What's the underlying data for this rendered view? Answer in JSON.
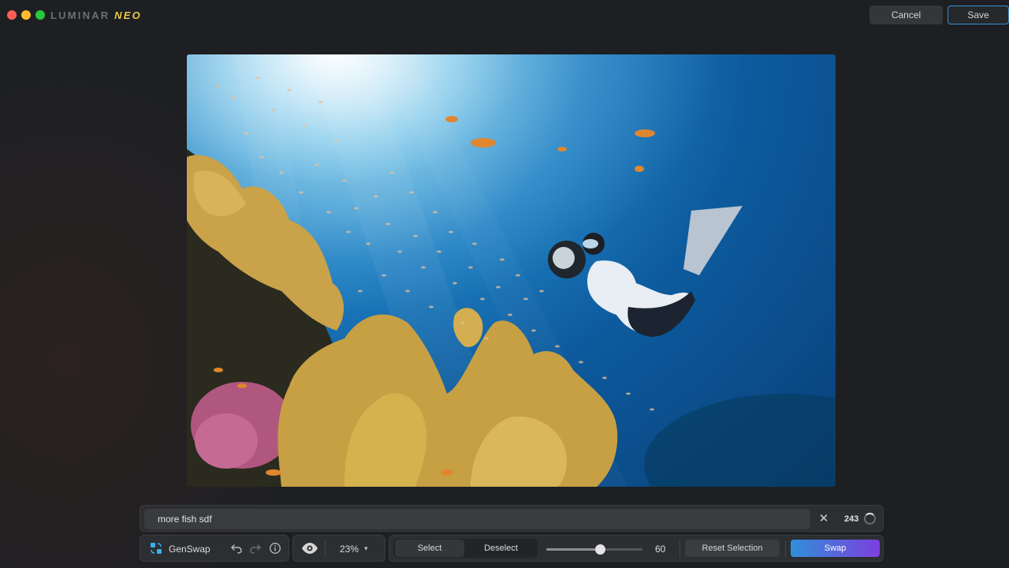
{
  "app": {
    "logo_part1": "LUMINAR",
    "logo_part2": "NEO"
  },
  "header": {
    "cancel_label": "Cancel",
    "save_label": "Save"
  },
  "prompt": {
    "value": "more fish sdf",
    "remaining_count": "243"
  },
  "toolbar": {
    "tool_label": "GenSwap",
    "zoom": "23%",
    "select_label": "Select",
    "deselect_label": "Deselect",
    "brush_size": "60",
    "brush_fraction": 0.56,
    "reset_label": "Reset Selection",
    "swap_label": "Swap"
  },
  "icons": {
    "tool": "genswap-icon",
    "undo": "undo-icon",
    "redo": "redo-icon",
    "info": "info-icon",
    "view": "eye-icon",
    "clear": "close-icon"
  },
  "colors": {
    "accent_start": "#2f8fd8",
    "accent_end": "#7c3fe0",
    "save_border": "#3b8fd6"
  }
}
